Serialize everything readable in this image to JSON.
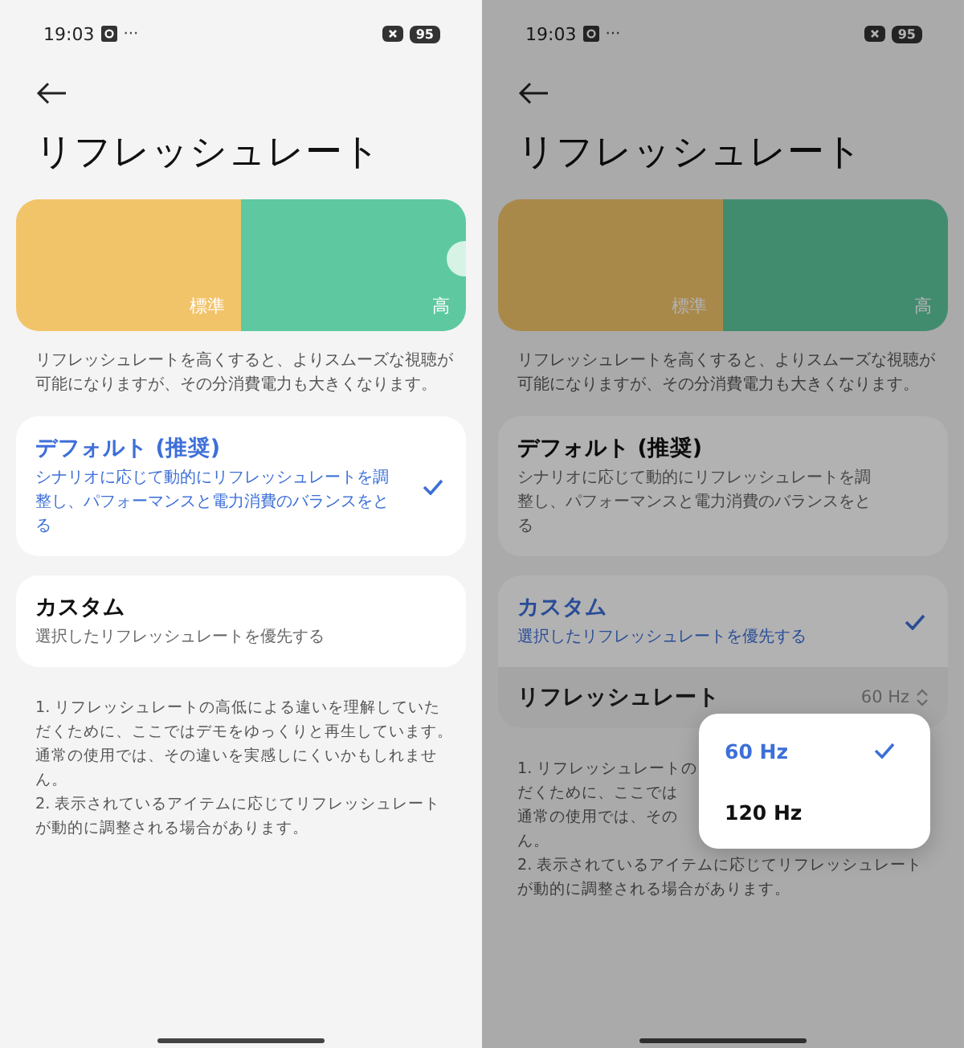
{
  "screens": [
    {
      "dimmed": false,
      "status_bar": {
        "time": "19:03",
        "more": "···",
        "battery": "95"
      },
      "title": "リフレッシュレート",
      "banner": {
        "labels": [
          "標準",
          "高"
        ]
      },
      "description_lines": [
        "リフレッシュレートを高くすると、よりスムーズな視聴が",
        "可能になりますが、その分消費電力も大きくなります。"
      ],
      "options": [
        {
          "title": "デフォルト (推奨)",
          "subtitle": "シナリオに応じて動的にリフレッシュレートを調整し、パフォーマンスと電力消費のバランスをとる",
          "selected": true
        },
        {
          "title": "カスタム",
          "subtitle": "選択したリフレッシュレートを優先する",
          "selected": false
        }
      ],
      "notes_lines": [
        "1. リフレッシュレートの高低による違いを理解していた",
        "だくために、ここではデモをゆっくりと再生しています。",
        "通常の使用では、その違いを実感しにくいかもしれませ",
        "ん。",
        "2. 表示されているアイテムに応じてリフレッシュレート",
        "が動的に調整される場合があります。"
      ]
    },
    {
      "dimmed": true,
      "status_bar": {
        "time": "19:03",
        "more": "···",
        "battery": "95"
      },
      "title": "リフレッシュレート",
      "banner": {
        "labels": [
          "標準",
          "高"
        ]
      },
      "description_lines": [
        "リフレッシュレートを高くすると、よりスムーズな視聴が",
        "可能になりますが、その分消費電力も大きくなります。"
      ],
      "options": [
        {
          "title": "デフォルト (推奨)",
          "subtitle": "シナリオに応じて動的にリフレッシュレートを調整し、パフォーマンスと電力消費のバランスをとる",
          "selected": false
        },
        {
          "title": "カスタム",
          "subtitle": "選択したリフレッシュレートを優先する",
          "selected": true
        }
      ],
      "rate_row": {
        "label": "リフレッシュレート",
        "value": "60 Hz"
      },
      "menu": [
        {
          "label": "60 Hz",
          "selected": true
        },
        {
          "label": "120 Hz",
          "selected": false
        }
      ],
      "notes_lines": [
        "1. リフレッシュレートの",
        "だくために、ここでは",
        "通常の使用では、その",
        "ん。",
        "2. 表示されているアイテムに応じてリフレッシュレート",
        "が動的に調整される場合があります。"
      ]
    }
  ]
}
